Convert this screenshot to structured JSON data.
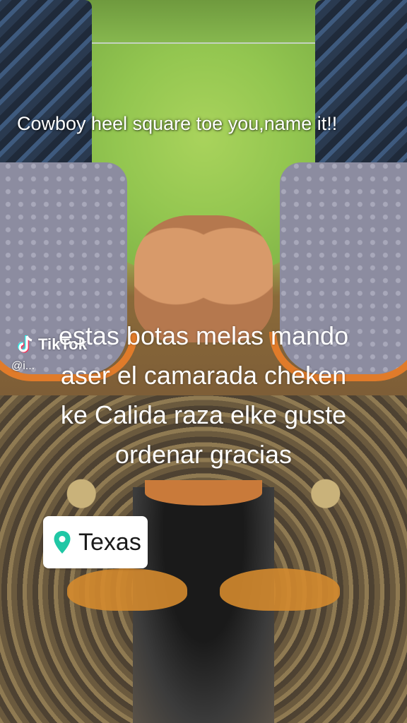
{
  "overlay": {
    "top_caption": "Cowboy heel square toe you,name it!!",
    "main_caption_lines": [
      "estas botas melas mando",
      "aser el camarada cheken",
      "ke Calida raza elke guste",
      "ordenar gracias"
    ]
  },
  "watermark": {
    "brand": "TikTok",
    "handle": "@i..."
  },
  "location_sticker": {
    "icon": "location-pin-icon",
    "label": "Texas",
    "pin_color": "#20c7a5"
  }
}
